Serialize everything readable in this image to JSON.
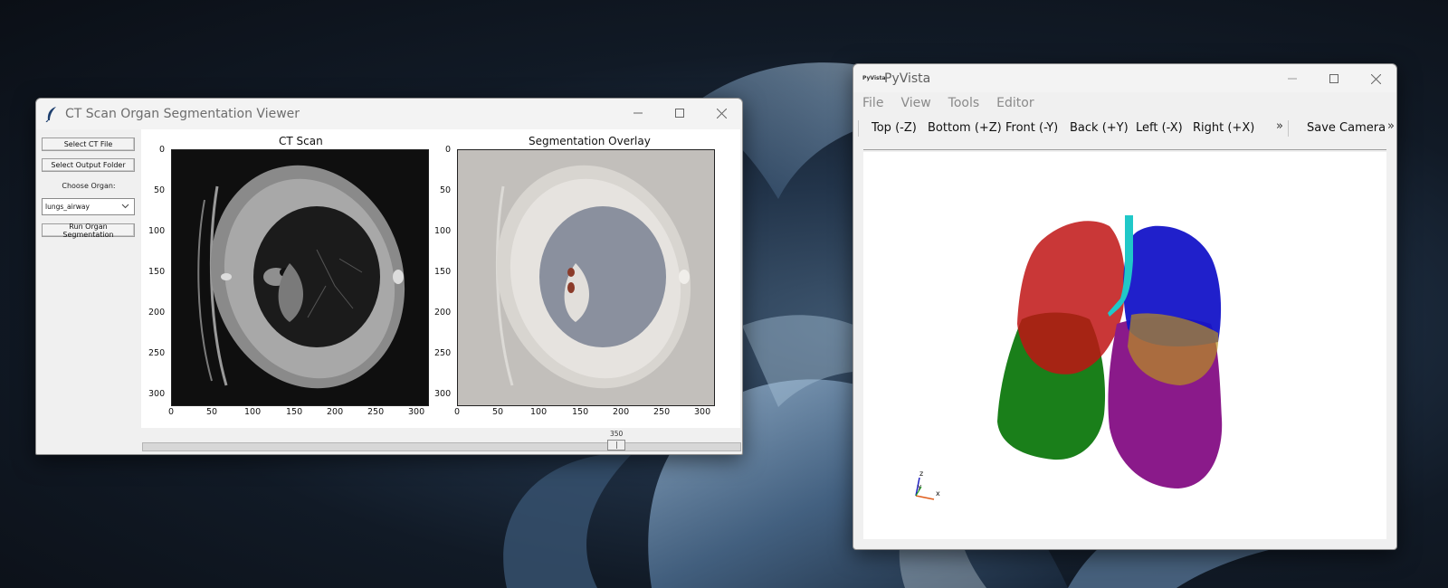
{
  "ct_window": {
    "title": "CT Scan Organ Segmentation Viewer",
    "buttons": {
      "select_ct": "Select CT File",
      "select_output": "Select Output Folder",
      "run": "Run Organ Segmentation"
    },
    "organ_label": "Choose Organ:",
    "organ_selected": "lungs_airway",
    "plots": {
      "left_title": "CT Scan",
      "right_title": "Segmentation Overlay",
      "y_ticks": [
        "0",
        "50",
        "100",
        "150",
        "200",
        "250",
        "300"
      ],
      "x_ticks": [
        "0",
        "50",
        "100",
        "150",
        "200",
        "250",
        "300"
      ]
    },
    "slider": {
      "value_label": "350",
      "fraction": 0.8
    }
  },
  "pv_window": {
    "logo_text": "PyVista",
    "title": "PyVista",
    "menu": [
      "File",
      "View",
      "Tools",
      "Editor"
    ],
    "toolbar": [
      "Top (-Z)",
      "Bottom (+Z)",
      "Front (-Y)",
      "Back (+Y)",
      "Left (-X)",
      "Right (+X)"
    ],
    "more_glyph": "»",
    "save_camera": "Save Camera",
    "axes": {
      "x": "x",
      "y": "y",
      "z": "z"
    },
    "colors": {
      "right_upper": "#c01414",
      "right_lower": "#1a7f1a",
      "left_upper": "#1414c8",
      "left_lower": "#8a1a8a",
      "middle": "#b89020",
      "airway": "#20c8c8"
    }
  }
}
